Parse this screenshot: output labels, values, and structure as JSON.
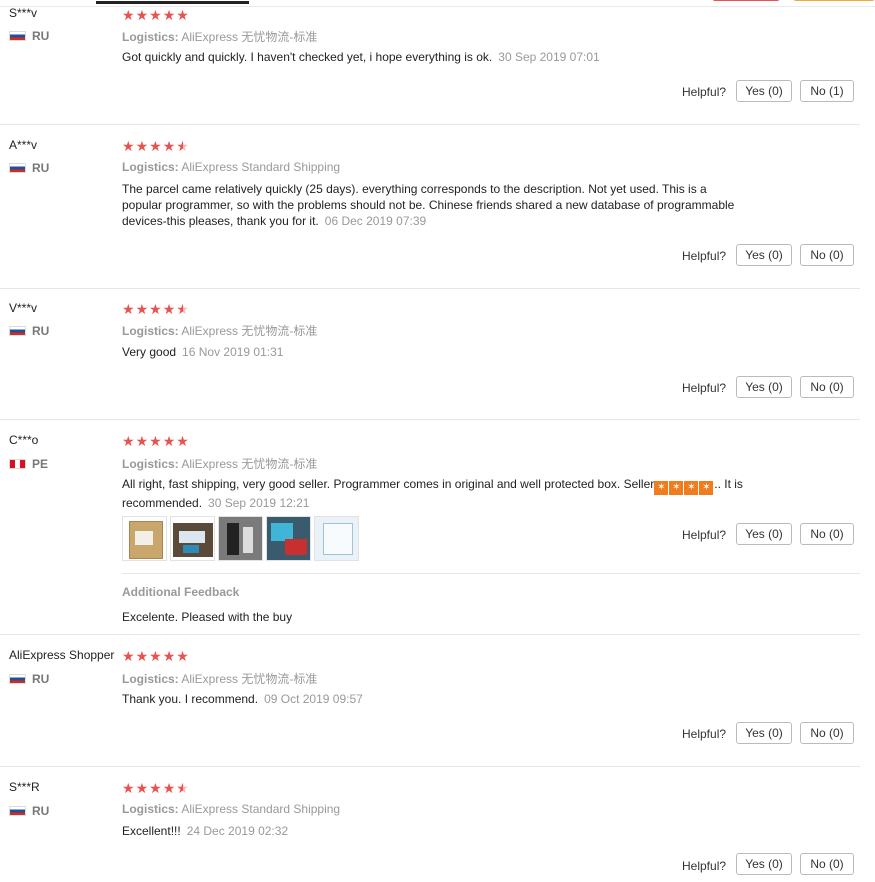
{
  "reviews": [
    {
      "user": "S***v",
      "country": "RU",
      "logistics_label": "Logistics:",
      "logistics": "AliExpress 无忧物流-标准",
      "text": "Got quickly and quickly. I haven't checked yet, i hope everything is ok.",
      "date": "30 Sep 2019 07:01",
      "helpful_label": "Helpful?",
      "yes": "Yes (0)",
      "no": "No (1)"
    },
    {
      "user": "A***v",
      "country": "RU",
      "logistics_label": "Logistics:",
      "logistics": "AliExpress Standard Shipping",
      "text": "The parcel came relatively quickly (25 days). everything corresponds to the description. Not yet used. This is a popular programmer, so with the problems should not be. Chinese friends shared a new database of programmable devices-this pleases, thank you for it.",
      "date": "06 Dec 2019 07:39",
      "helpful_label": "Helpful?",
      "yes": "Yes (0)",
      "no": "No (0)"
    },
    {
      "user": "V***v",
      "country": "RU",
      "logistics_label": "Logistics:",
      "logistics": "AliExpress 无忧物流-标准",
      "text": "Very good",
      "date": "16 Nov 2019 01:31",
      "helpful_label": "Helpful?",
      "yes": "Yes (0)",
      "no": "No (0)"
    },
    {
      "user": "C***o",
      "country": "PE",
      "logistics_label": "Logistics:",
      "logistics": "AliExpress 无忧物流-标准",
      "text_before": "All right, fast shipping, very good seller. Programmer comes in original and well protected box. Seller",
      "text_after": ".. It is recommended.",
      "date": "30 Sep 2019 12:21",
      "helpful_label": "Helpful?",
      "yes": "Yes (0)",
      "no": "No (0)",
      "additional_feedback_title": "Additional Feedback",
      "additional_feedback": "Excelente. Pleased with the buy"
    },
    {
      "user": "AliExpress Shopper",
      "country": "RU",
      "logistics_label": "Logistics:",
      "logistics": "AliExpress 无忧物流-标准",
      "text": "Thank you. I recommend.",
      "date": "09 Oct 2019 09:57",
      "helpful_label": "Helpful?",
      "yes": "Yes (0)",
      "no": "No (0)"
    },
    {
      "user": "S***R",
      "country": "RU",
      "logistics_label": "Logistics:",
      "logistics": "AliExpress Standard Shipping",
      "text": "Excellent!!!",
      "date": "24 Dec 2019 02:32",
      "helpful_label": "Helpful?",
      "yes": "Yes (0)",
      "no": "No (0)"
    }
  ],
  "colors": {
    "star": "#e8524f",
    "seller_icon": "#f07c1e"
  },
  "ratings": [
    5,
    4.5,
    4.5,
    5,
    5,
    4.5
  ]
}
